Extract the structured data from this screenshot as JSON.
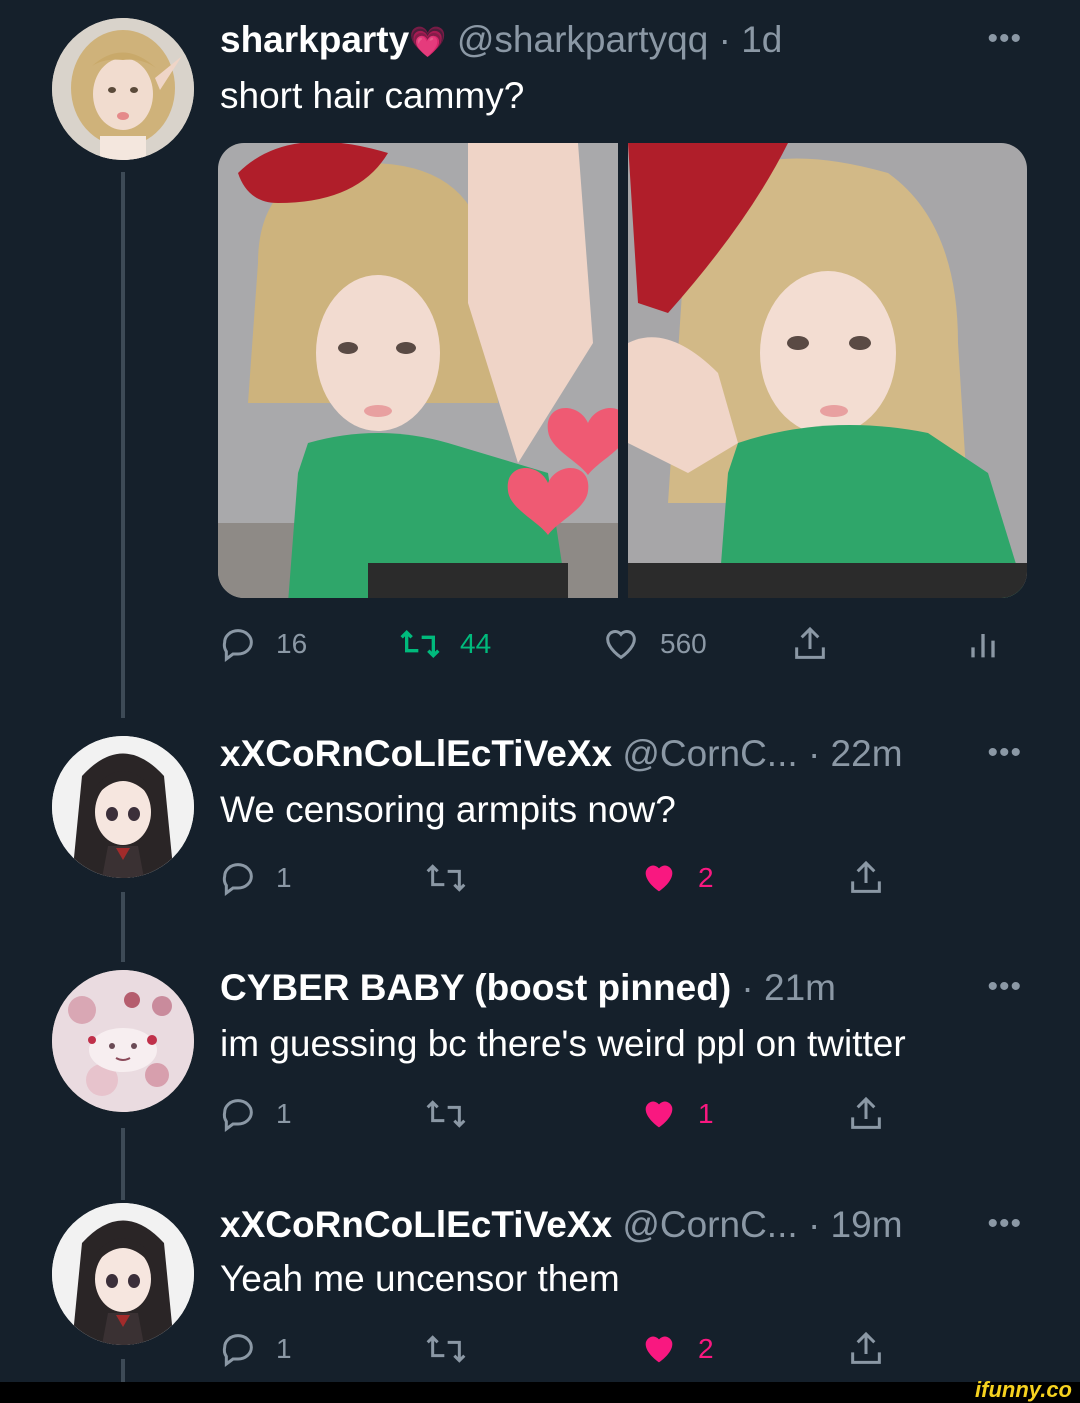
{
  "tweets": [
    {
      "display_name": "sharkparty",
      "name_emoji": "💗",
      "handle": "@sharkpartyqq",
      "time": "· 1d",
      "more_label": "•••",
      "text": "short hair cammy?",
      "replies": "16",
      "retweets": "44",
      "likes": "560",
      "retweeted": true,
      "liked": false
    },
    {
      "display_name": "xXCoRnCoLlEcTiVeXx",
      "handle": "@CornC...",
      "time": "· 22m",
      "more_label": "•••",
      "text": "We censoring armpits now?",
      "replies": "1",
      "retweets": "",
      "likes": "2",
      "liked": true
    },
    {
      "display_name": "CYBER BABY (boost pinned)",
      "handle": "",
      "time": "· 21m",
      "more_label": "•••",
      "text": "im guessing bc there's weird ppl on twitter",
      "replies": "1",
      "retweets": "",
      "likes": "1",
      "liked": true
    },
    {
      "display_name": "xXCoRnCoLlEcTiVeXx",
      "handle": "@CornC...",
      "time": "· 19m",
      "more_label": "•••",
      "text": "Yeah me uncensor them",
      "replies": "1",
      "retweets": "",
      "likes": "2",
      "liked": true
    }
  ],
  "footer": {
    "watermark": "ifunny.co"
  },
  "colors": {
    "background": "#15202b",
    "muted": "#8b98a5",
    "retweet_green": "#00ba7c",
    "like_pink": "#f91880",
    "shirt_green": "#2fa66a",
    "beret_red": "#b01e2a"
  },
  "icons": [
    "reply-icon",
    "retweet-icon",
    "like-icon",
    "share-icon",
    "analytics-icon",
    "more-icon"
  ]
}
